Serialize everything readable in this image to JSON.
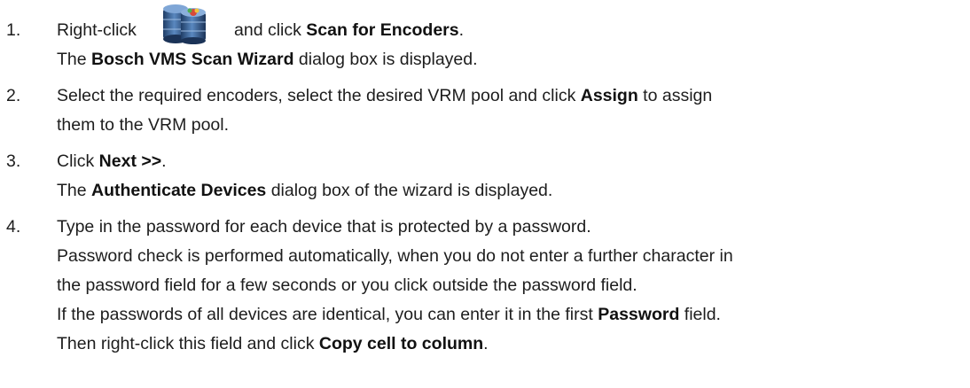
{
  "steps": [
    {
      "number": "1.",
      "lines": [
        {
          "pre": "Right-click",
          "bold": "",
          "post": ""
        },
        {
          "pre": "and click ",
          "bold": "Scan for Encoders",
          "post": "."
        },
        {
          "pre": "The ",
          "bold": "Bosch VMS Scan Wizard",
          "post": " dialog box is displayed."
        }
      ],
      "icon": "vrm-pool-icon"
    },
    {
      "number": "2.",
      "lines": [
        {
          "pre": "Select the required encoders, select the desired VRM pool and click ",
          "bold": "Assign",
          "post": " to assign"
        },
        {
          "pre": "them to the VRM pool.",
          "bold": "",
          "post": ""
        }
      ]
    },
    {
      "number": "3.",
      "lines": [
        {
          "pre": "Click ",
          "bold": "Next >>",
          "post": "."
        },
        {
          "pre": "The ",
          "bold": "Authenticate Devices",
          "post": " dialog box of the wizard is displayed."
        }
      ]
    },
    {
      "number": "4.",
      "lines": [
        {
          "pre": "Type in the password for each device that is protected by a password.",
          "bold": "",
          "post": ""
        },
        {
          "pre": "Password check is performed automatically, when you do not enter a further character in",
          "bold": "",
          "post": ""
        },
        {
          "pre": "the password field for a few seconds or you click outside the password field.",
          "bold": "",
          "post": ""
        },
        {
          "pre": "If the passwords of all devices are identical, you can enter it in the first ",
          "bold": "Password",
          "post": " field."
        },
        {
          "pre": "Then right-click this field and click ",
          "bold": "Copy cell to column",
          "post": "."
        }
      ]
    }
  ]
}
